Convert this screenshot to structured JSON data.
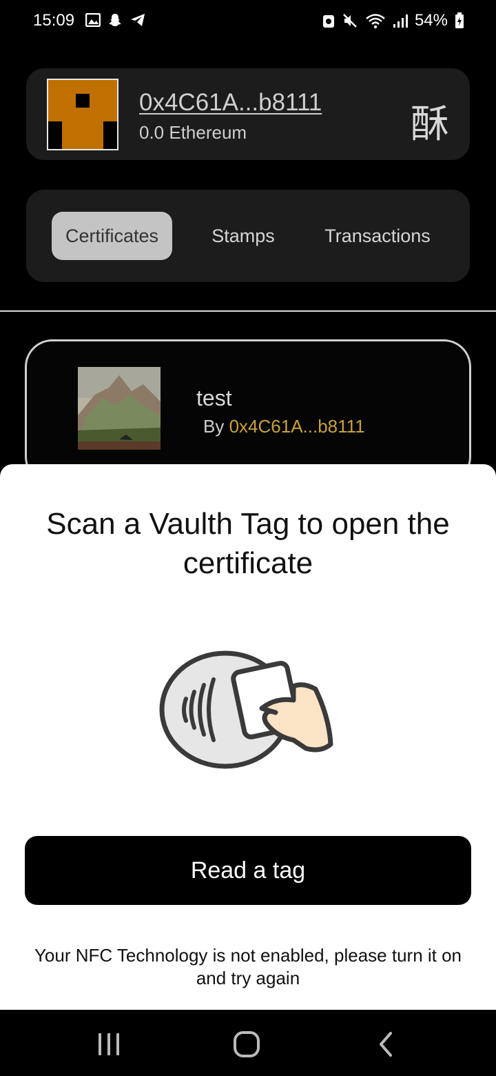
{
  "status_bar": {
    "time": "15:09",
    "battery": "54%",
    "left_icons": [
      "gallery-icon",
      "snapchat-icon",
      "telegram-icon"
    ],
    "right_icons": [
      "alarm-lock-icon",
      "mute-icon",
      "wifi-icon",
      "signal-icon",
      "battery-charging-icon"
    ]
  },
  "wallet": {
    "address": "0x4C61A...b8111",
    "balance": "0.0 Ethereum",
    "currency_glyph": "酥",
    "identicon_color": "#c07000"
  },
  "tabs": [
    {
      "label": "Certificates",
      "active": true
    },
    {
      "label": "Stamps",
      "active": false
    },
    {
      "label": "Transactions",
      "active": false
    }
  ],
  "certificate": {
    "title": "test",
    "by_prefix": "By",
    "by_address": "0x4C61A...b8111"
  },
  "sheet": {
    "title": "Scan a Vaulth Tag to open the certificate",
    "button_label": "Read a tag",
    "warning": "Your NFC Technology is not enabled, please turn it on and try again",
    "illustration": "nfc-tap-icon"
  },
  "nav": {
    "buttons": [
      "recent-apps-icon",
      "home-icon",
      "back-icon"
    ]
  },
  "colors": {
    "accent_gold": "#c9a23a",
    "card_bg": "#1c1c1c",
    "active_tab_bg": "#c4c4c4"
  }
}
